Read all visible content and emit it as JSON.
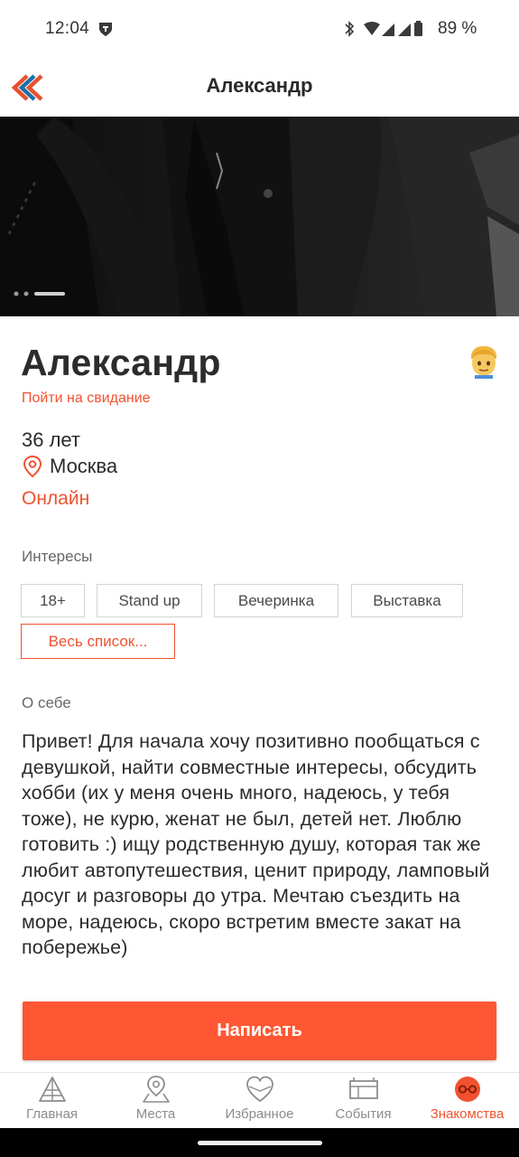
{
  "status_bar": {
    "time": "12:04",
    "battery": "89 %"
  },
  "header": {
    "title": "Александр",
    "back_icon": "double-chevron-left-icon"
  },
  "photo": {
    "page_count": 3,
    "active_page": 3
  },
  "profile": {
    "name": "Александр",
    "date_link": "Пойти на свидание",
    "age": "36 лет",
    "city": "Москва",
    "online": "Онлайн"
  },
  "interests": {
    "heading": "Интересы",
    "items": [
      "18+",
      "Stand up",
      "Вечеринка",
      "Выставка"
    ],
    "all_label": "Весь список..."
  },
  "about": {
    "heading": "О себе",
    "text": "Привет! Для начала хочу позитивно пообщаться с девушкой, найти совместные интересы, обсудить хобби (их у меня очень много, надеюсь, у тебя тоже), не курю, женат не был, детей нет. Люблю готовить :) ищу родственную душу, которая так же любит автопутешествия, ценит природу, ламповый досуг и разговоры до утра. Мечтаю съездить на море, надеюсь, скоро встретим вместе закат на побережье)"
  },
  "actions": {
    "write_label": "Написать"
  },
  "bottom_nav": {
    "items": [
      {
        "label": "Главная",
        "icon": "home-icon"
      },
      {
        "label": "Места",
        "icon": "map-pin-icon"
      },
      {
        "label": "Избранное",
        "icon": "heart-icon"
      },
      {
        "label": "События",
        "icon": "calendar-icon"
      },
      {
        "label": "Знакомства",
        "icon": "dating-icon"
      }
    ],
    "active": "Знакомства"
  },
  "colors": {
    "accent": "#f0522e",
    "button": "#ff5733",
    "text": "#2b2b2b",
    "muted": "#8c8c8c"
  }
}
